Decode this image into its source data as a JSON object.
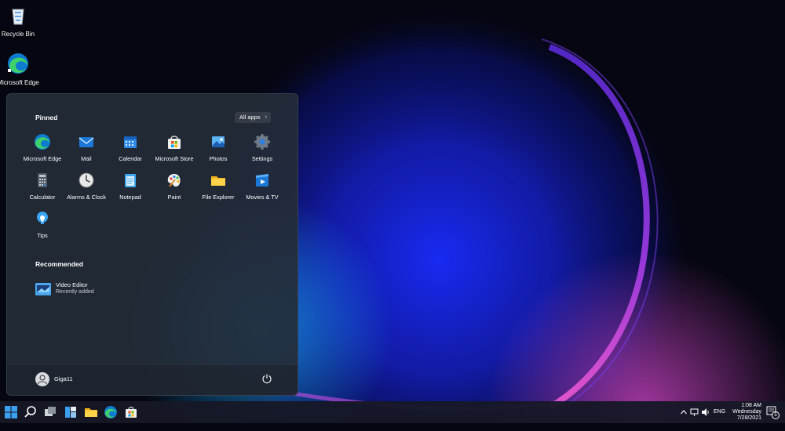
{
  "desktop": {
    "icons": [
      {
        "label": "Recycle Bin"
      },
      {
        "label": "Microsoft Edge"
      }
    ]
  },
  "start_menu": {
    "pinned_title": "Pinned",
    "all_apps_label": "All apps",
    "pinned": [
      {
        "label": "Microsoft Edge",
        "icon": "edge-icon"
      },
      {
        "label": "Mail",
        "icon": "mail-icon"
      },
      {
        "label": "Calendar",
        "icon": "calendar-icon"
      },
      {
        "label": "Microsoft Store",
        "icon": "store-icon"
      },
      {
        "label": "Photos",
        "icon": "photos-icon"
      },
      {
        "label": "Settings",
        "icon": "gear-icon"
      },
      {
        "label": "Calculator",
        "icon": "calculator-icon"
      },
      {
        "label": "Alarms & Clock",
        "icon": "clock-icon"
      },
      {
        "label": "Notepad",
        "icon": "notepad-icon"
      },
      {
        "label": "Paint",
        "icon": "palette-icon"
      },
      {
        "label": "File Explorer",
        "icon": "folder-icon"
      },
      {
        "label": "Movies & TV",
        "icon": "play-icon"
      },
      {
        "label": "Tips",
        "icon": "lightbulb-icon"
      }
    ],
    "recommended_title": "Recommended",
    "recommended": [
      {
        "title": "Video Editor",
        "subtitle": "Recently added",
        "icon": "video-editor-icon"
      }
    ],
    "user": {
      "name": "Giga11"
    }
  },
  "taskbar": {
    "language": "ENG",
    "time": "1:08 AM",
    "day": "Wednesday",
    "date": "7/28/2021",
    "notification_count": "5"
  },
  "colors": {
    "accent": "#3a8ee6",
    "start_bg": "#242c38",
    "taskbar_bg": "#161826"
  }
}
